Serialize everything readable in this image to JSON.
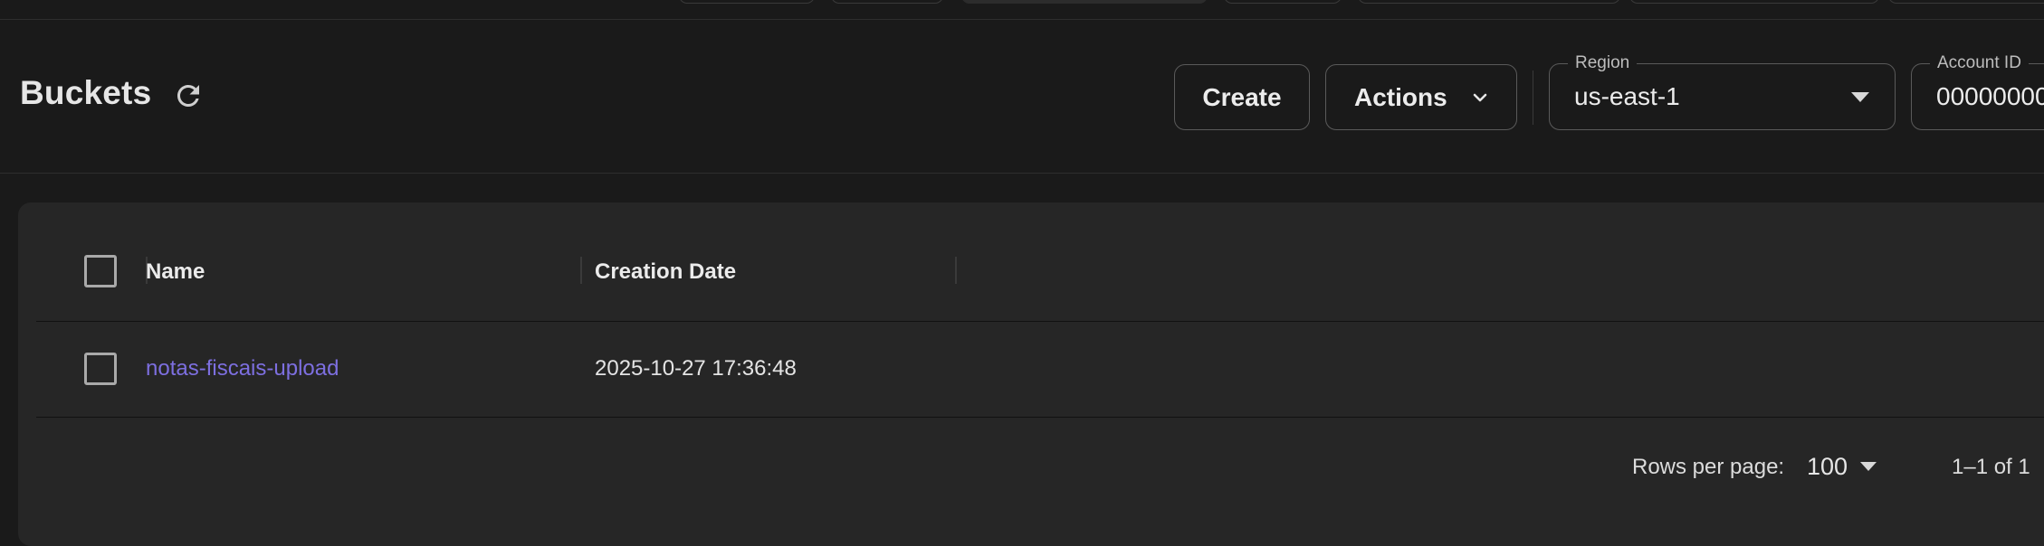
{
  "header": {
    "title": "Buckets",
    "create_label": "Create",
    "actions_label": "Actions",
    "region": {
      "label": "Region",
      "value": "us-east-1"
    },
    "account": {
      "label": "Account ID",
      "value": "00000000"
    }
  },
  "table": {
    "columns": [
      "Name",
      "Creation Date"
    ],
    "rows": [
      {
        "name": "notas-fiscais-upload",
        "creation_date": "2025-10-27 17:36:48"
      }
    ]
  },
  "pagination": {
    "rows_per_page_label": "Rows per page:",
    "rows_per_page_value": "100",
    "range": "1–1 of 1"
  },
  "colors": {
    "background": "#1a1a1a",
    "card": "#262626",
    "link": "#7d6fe0",
    "border": "#5a5a5a"
  },
  "icons": [
    "refresh-icon",
    "chevron-down-icon",
    "caret-down-icon",
    "checkbox-icon"
  ]
}
